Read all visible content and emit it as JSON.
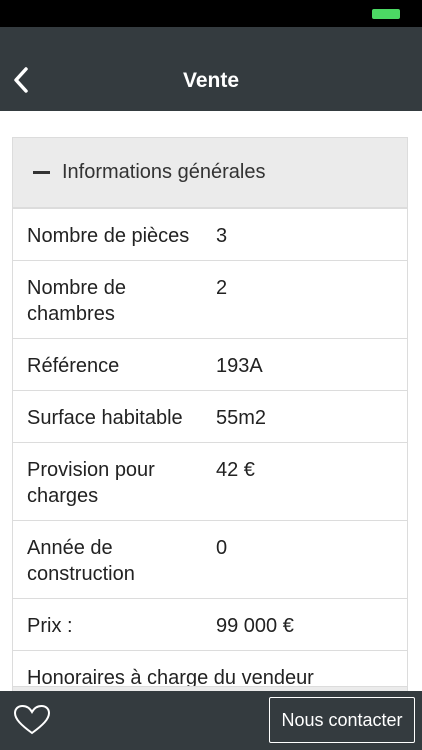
{
  "nav": {
    "title": "Vente",
    "back_icon": "chevron-left-icon",
    "bar_color": "#343b3f"
  },
  "status_bar": {
    "battery_color": "#4cd964"
  },
  "section": {
    "title": "Informations générales",
    "toggle_icon": "minus-icon",
    "rows": [
      {
        "label": "Nombre de pièces",
        "value": "3"
      },
      {
        "label": "Nombre de chambres",
        "value": "2"
      },
      {
        "label": "Référence",
        "value": "193A"
      },
      {
        "label": "Surface habitable",
        "value": "55m2"
      },
      {
        "label": "Provision pour charges",
        "value": "42 €"
      },
      {
        "label": "Année de construction",
        "value": "0"
      },
      {
        "label": "Prix :",
        "value": "99 000 €"
      }
    ],
    "note": "Honoraires à charge du vendeur"
  },
  "bottom": {
    "favorite_icon": "heart-icon",
    "contact_label": "Nous contacter"
  }
}
